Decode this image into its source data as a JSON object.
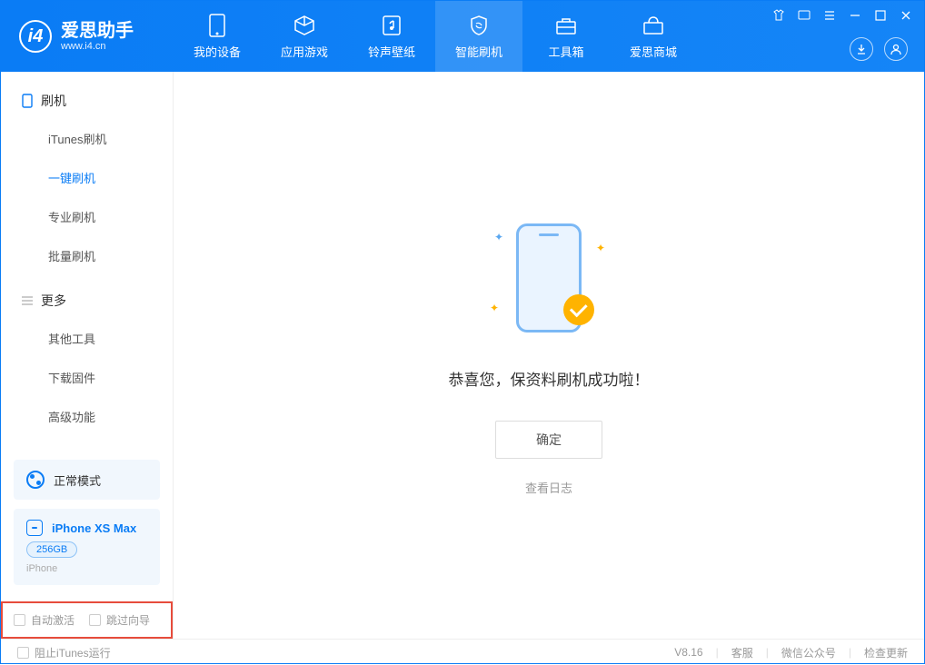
{
  "app": {
    "title": "爱思助手",
    "subtitle": "www.i4.cn"
  },
  "nav": [
    {
      "label": "我的设备"
    },
    {
      "label": "应用游戏"
    },
    {
      "label": "铃声壁纸"
    },
    {
      "label": "智能刷机"
    },
    {
      "label": "工具箱"
    },
    {
      "label": "爱思商城"
    }
  ],
  "sidebar": {
    "section1": {
      "title": "刷机",
      "items": [
        "iTunes刷机",
        "一键刷机",
        "专业刷机",
        "批量刷机"
      ]
    },
    "section2": {
      "title": "更多",
      "items": [
        "其他工具",
        "下载固件",
        "高级功能"
      ]
    }
  },
  "mode": {
    "label": "正常模式"
  },
  "device": {
    "name": "iPhone XS Max",
    "storage": "256GB",
    "type": "iPhone"
  },
  "checkboxes": {
    "auto_activate": "自动激活",
    "skip_guide": "跳过向导"
  },
  "main": {
    "success": "恭喜您，保资料刷机成功啦！",
    "confirm": "确定",
    "log": "查看日志"
  },
  "footer": {
    "block_itunes": "阻止iTunes运行",
    "version": "V8.16",
    "links": [
      "客服",
      "微信公众号",
      "检查更新"
    ]
  }
}
